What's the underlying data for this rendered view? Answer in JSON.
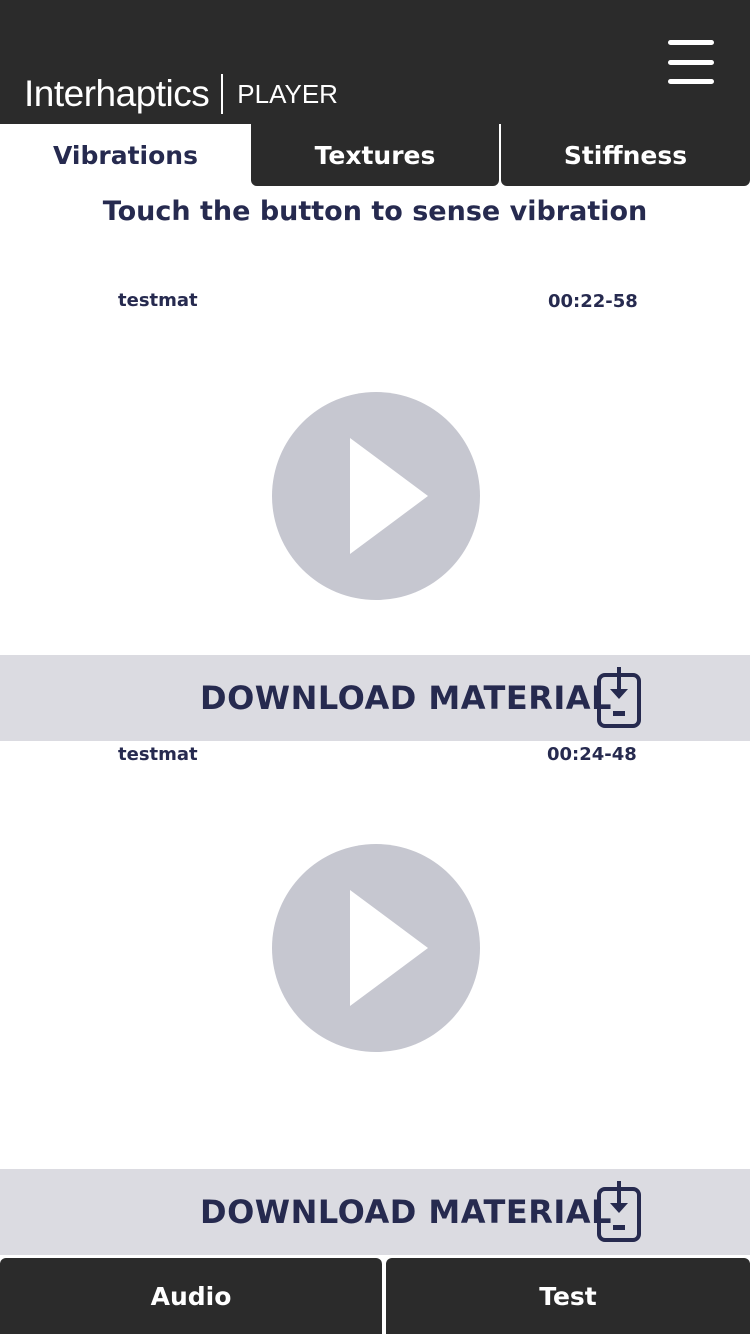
{
  "header": {
    "brand_name": "Interhaptics",
    "brand_sub": "PLAYER",
    "menu_icon": "hamburger-menu-icon"
  },
  "tabs": [
    {
      "label": "Vibrations",
      "active": true
    },
    {
      "label": "Textures",
      "active": false
    },
    {
      "label": "Stiffness",
      "active": false
    }
  ],
  "instruction": "Touch the button to sense vibration",
  "materials": [
    {
      "name": "testmat",
      "time": "00:22-58",
      "download_label": "DOWNLOAD MATERIAL",
      "play_icon": "play-icon",
      "download_icon": "download-to-phone-icon"
    },
    {
      "name": "testmat",
      "time": "00:24-48",
      "download_label": "DOWNLOAD MATERIAL",
      "play_icon": "play-icon",
      "download_icon": "download-to-phone-icon"
    }
  ],
  "bottom_nav": [
    {
      "label": "Audio"
    },
    {
      "label": "Test"
    }
  ],
  "colors": {
    "header_bg": "#2b2b2b",
    "text_dark": "#262a4f",
    "play_bg": "#c6c7d0",
    "download_bg": "#dbdbe1"
  }
}
